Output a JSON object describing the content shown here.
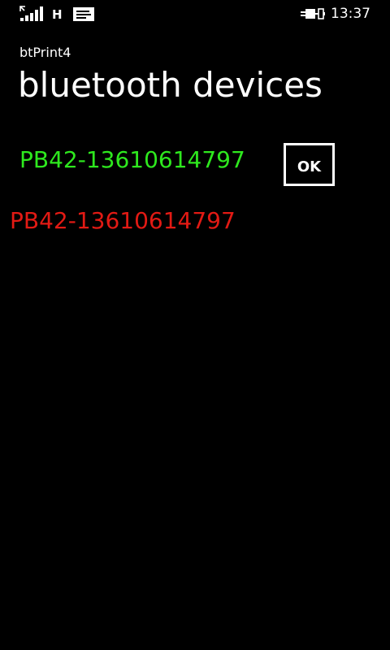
{
  "status_bar": {
    "signal_icon": "signal-strength-icon",
    "network_type": "H",
    "message_icon": "message-icon",
    "power_icon": "charging-plug-icon",
    "time": "13:37"
  },
  "header": {
    "app_title": "btPrint4",
    "page_title": "bluetooth devices"
  },
  "devices": {
    "connected_name": "PB42-13610614797",
    "found_name": "PB42-13610614797"
  },
  "buttons": {
    "ok_label": "OK"
  },
  "colors": {
    "background": "#000000",
    "text": "#ffffff",
    "connected_device": "#2ee81e",
    "found_device": "#e21a14"
  }
}
